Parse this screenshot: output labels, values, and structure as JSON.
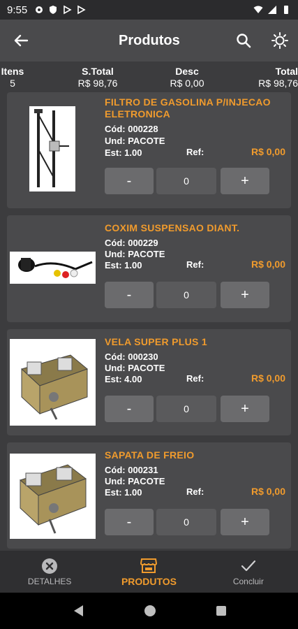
{
  "status_bar": {
    "time": "9:55",
    "icons": [
      "gear-icon",
      "shield-icon",
      "play-icon",
      "play-icon"
    ],
    "right_icons": [
      "wifi-icon",
      "signal-icon",
      "battery-icon"
    ]
  },
  "app_bar": {
    "title": "Produtos",
    "back_icon": "arrow-left-icon",
    "actions": [
      "search-icon",
      "brightness-icon"
    ]
  },
  "summary": {
    "itens_label": "Itens",
    "itens_value": "5",
    "stotal_label": "S.Total",
    "stotal_value": "R$ 98,76",
    "desc_label": "Desc",
    "desc_value": "R$ 0,00",
    "total_label": "Total",
    "total_value": "R$ 98,76"
  },
  "products": [
    {
      "name": "FILTRO DE GASOLINA P/INJECAO ELETRONICA",
      "cod": "Cód: 000228",
      "und": "Und: PACOTE",
      "est": "Est: 1.00",
      "ref": "Ref:",
      "price": "R$ 0,00",
      "qty": "0",
      "minus": "-",
      "plus": "+"
    },
    {
      "name": "COXIM SUSPENSAO DIANT.",
      "cod": "Cód: 000229",
      "und": "Und: PACOTE",
      "est": "Est: 1.00",
      "ref": "Ref:",
      "price": "R$ 0,00",
      "qty": "0",
      "minus": "-",
      "plus": "+"
    },
    {
      "name": "VELA SUPER PLUS 1",
      "cod": "Cód: 000230",
      "und": "Und: PACOTE",
      "est": "Est: 4.00",
      "ref": "Ref:",
      "price": "R$ 0,00",
      "qty": "0",
      "minus": "-",
      "plus": "+"
    },
    {
      "name": "SAPATA DE FREIO",
      "cod": "Cód: 000231",
      "und": "Und: PACOTE",
      "est": "Est: 1.00",
      "ref": "Ref:",
      "price": "R$ 0,00",
      "qty": "0",
      "minus": "-",
      "plus": "+"
    }
  ],
  "bottom_nav": [
    {
      "label": "DETALHES",
      "icon": "close-circle-icon",
      "active": false
    },
    {
      "label": "PRODUTOS",
      "icon": "store-icon",
      "active": true
    },
    {
      "label": "Concluir",
      "icon": "check-icon",
      "active": false
    }
  ],
  "colors": {
    "accent": "#f09b2d",
    "card": "#4a4a4c",
    "background": "#3c3c3e"
  }
}
